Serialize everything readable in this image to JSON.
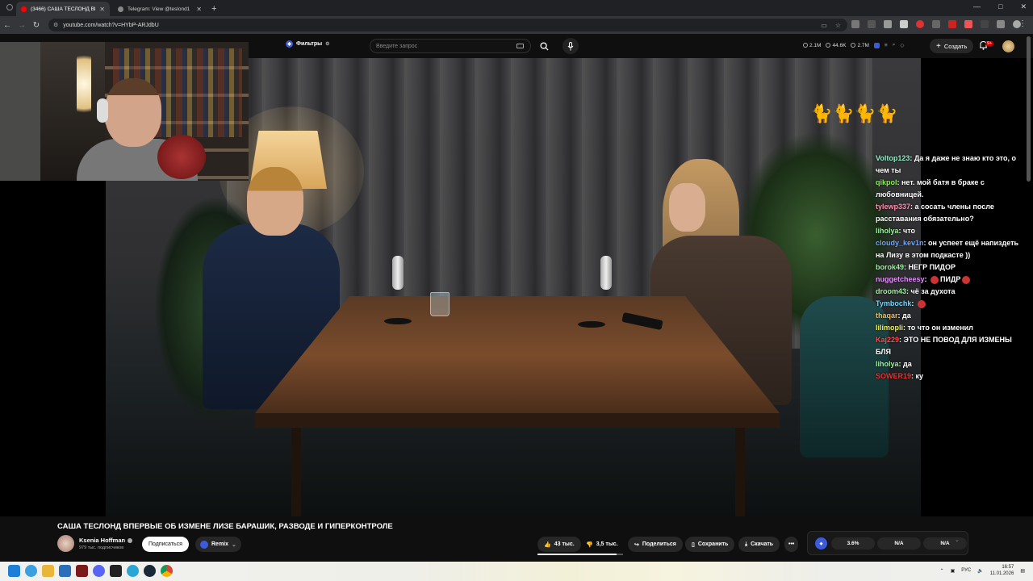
{
  "browser": {
    "tabs": [
      {
        "title": "(3466) САША ТЕСЛОНД ВПЕРВ",
        "active": true
      },
      {
        "title": "Telegram: View @teslond1",
        "active": false
      }
    ],
    "url": "youtube.com/watch?v=HYbP-ARJdbU",
    "window_controls": [
      "—",
      "□",
      "✕"
    ]
  },
  "yt_header": {
    "filters_label": "Фильтры",
    "search_placeholder": "Введите запрос",
    "stats": [
      "2.1M",
      "44.6K",
      "2.7M"
    ],
    "create_label": "Создать",
    "notif_badge": "9+"
  },
  "overlay": {
    "chat": [
      {
        "user": "Voltop123",
        "color": "#8ef0c8",
        "text": "Да я даже не знаю кто это, о чем ты"
      },
      {
        "user": "qikpol",
        "color": "#8ef05a",
        "text": "нет. мой батя в браке с любовницей."
      },
      {
        "user": "tylewp337",
        "color": "#ff8fb0",
        "text": "а сосать члены после расставания обязательно?"
      },
      {
        "user": "liholya",
        "color": "#9ef0a0",
        "text": "что"
      },
      {
        "user": "cloudy_kev1n",
        "color": "#6fa8ff",
        "text": "он успеет ещё напиздеть на Лизу в этом подкасте ))"
      },
      {
        "user": "borok49",
        "color": "#9ef0a0",
        "text": "НЕГР ПИДОР"
      },
      {
        "user": "nuggetcheesy",
        "color": "#e88fff",
        "text": "ПИДР"
      },
      {
        "user": "droom43",
        "color": "#9ef0a0",
        "text": "чё за духота"
      },
      {
        "user": "Tymbochk",
        "color": "#6fd8ff",
        "text": ""
      },
      {
        "user": "thaqar",
        "color": "#f0c060",
        "text": "да"
      },
      {
        "user": "lilimopli",
        "color": "#f0f060",
        "text": "то что он изменил"
      },
      {
        "user": "Kaj229",
        "color": "#ff4a4a",
        "text": "ЭТО НЕ ПОВОД ДЛЯ ИЗМЕНЫ БЛЯ"
      },
      {
        "user": "liholya",
        "color": "#9ef0a0",
        "text": "да"
      },
      {
        "user": "SOWER19",
        "color": "#ff2a2a",
        "text": "ку"
      }
    ]
  },
  "video": {
    "title": "САША ТЕСЛОНД ВПЕРВЫЕ ОБ ИЗМЕНЕ ЛИЗЕ БАРАШИК, РАЗВОДЕ И ГИПЕРКОНТРОЛЕ",
    "channel": "Ksenia Hoffman",
    "subscribers": "979 тыс. подписчиков",
    "subscribe_label": "Подписаться",
    "remix_label": "Remix",
    "likes": "43 тыс.",
    "dislikes": "3,5 тыс.",
    "like_ratio": 0.92,
    "share_label": "Поделиться",
    "save_label": "Сохранить",
    "download_label": "Скачать",
    "more_label": "•••"
  },
  "ext_panel": {
    "values": [
      "3.6%",
      "N/A",
      "N/A"
    ]
  },
  "taskbar": {
    "lang": "РУС",
    "time": "16:57",
    "date": "11.01.2026"
  },
  "colors": {
    "yt_bg": "#0f0f0f",
    "accent_blue": "#3b5bdb",
    "youtube_red": "#ff0000"
  }
}
